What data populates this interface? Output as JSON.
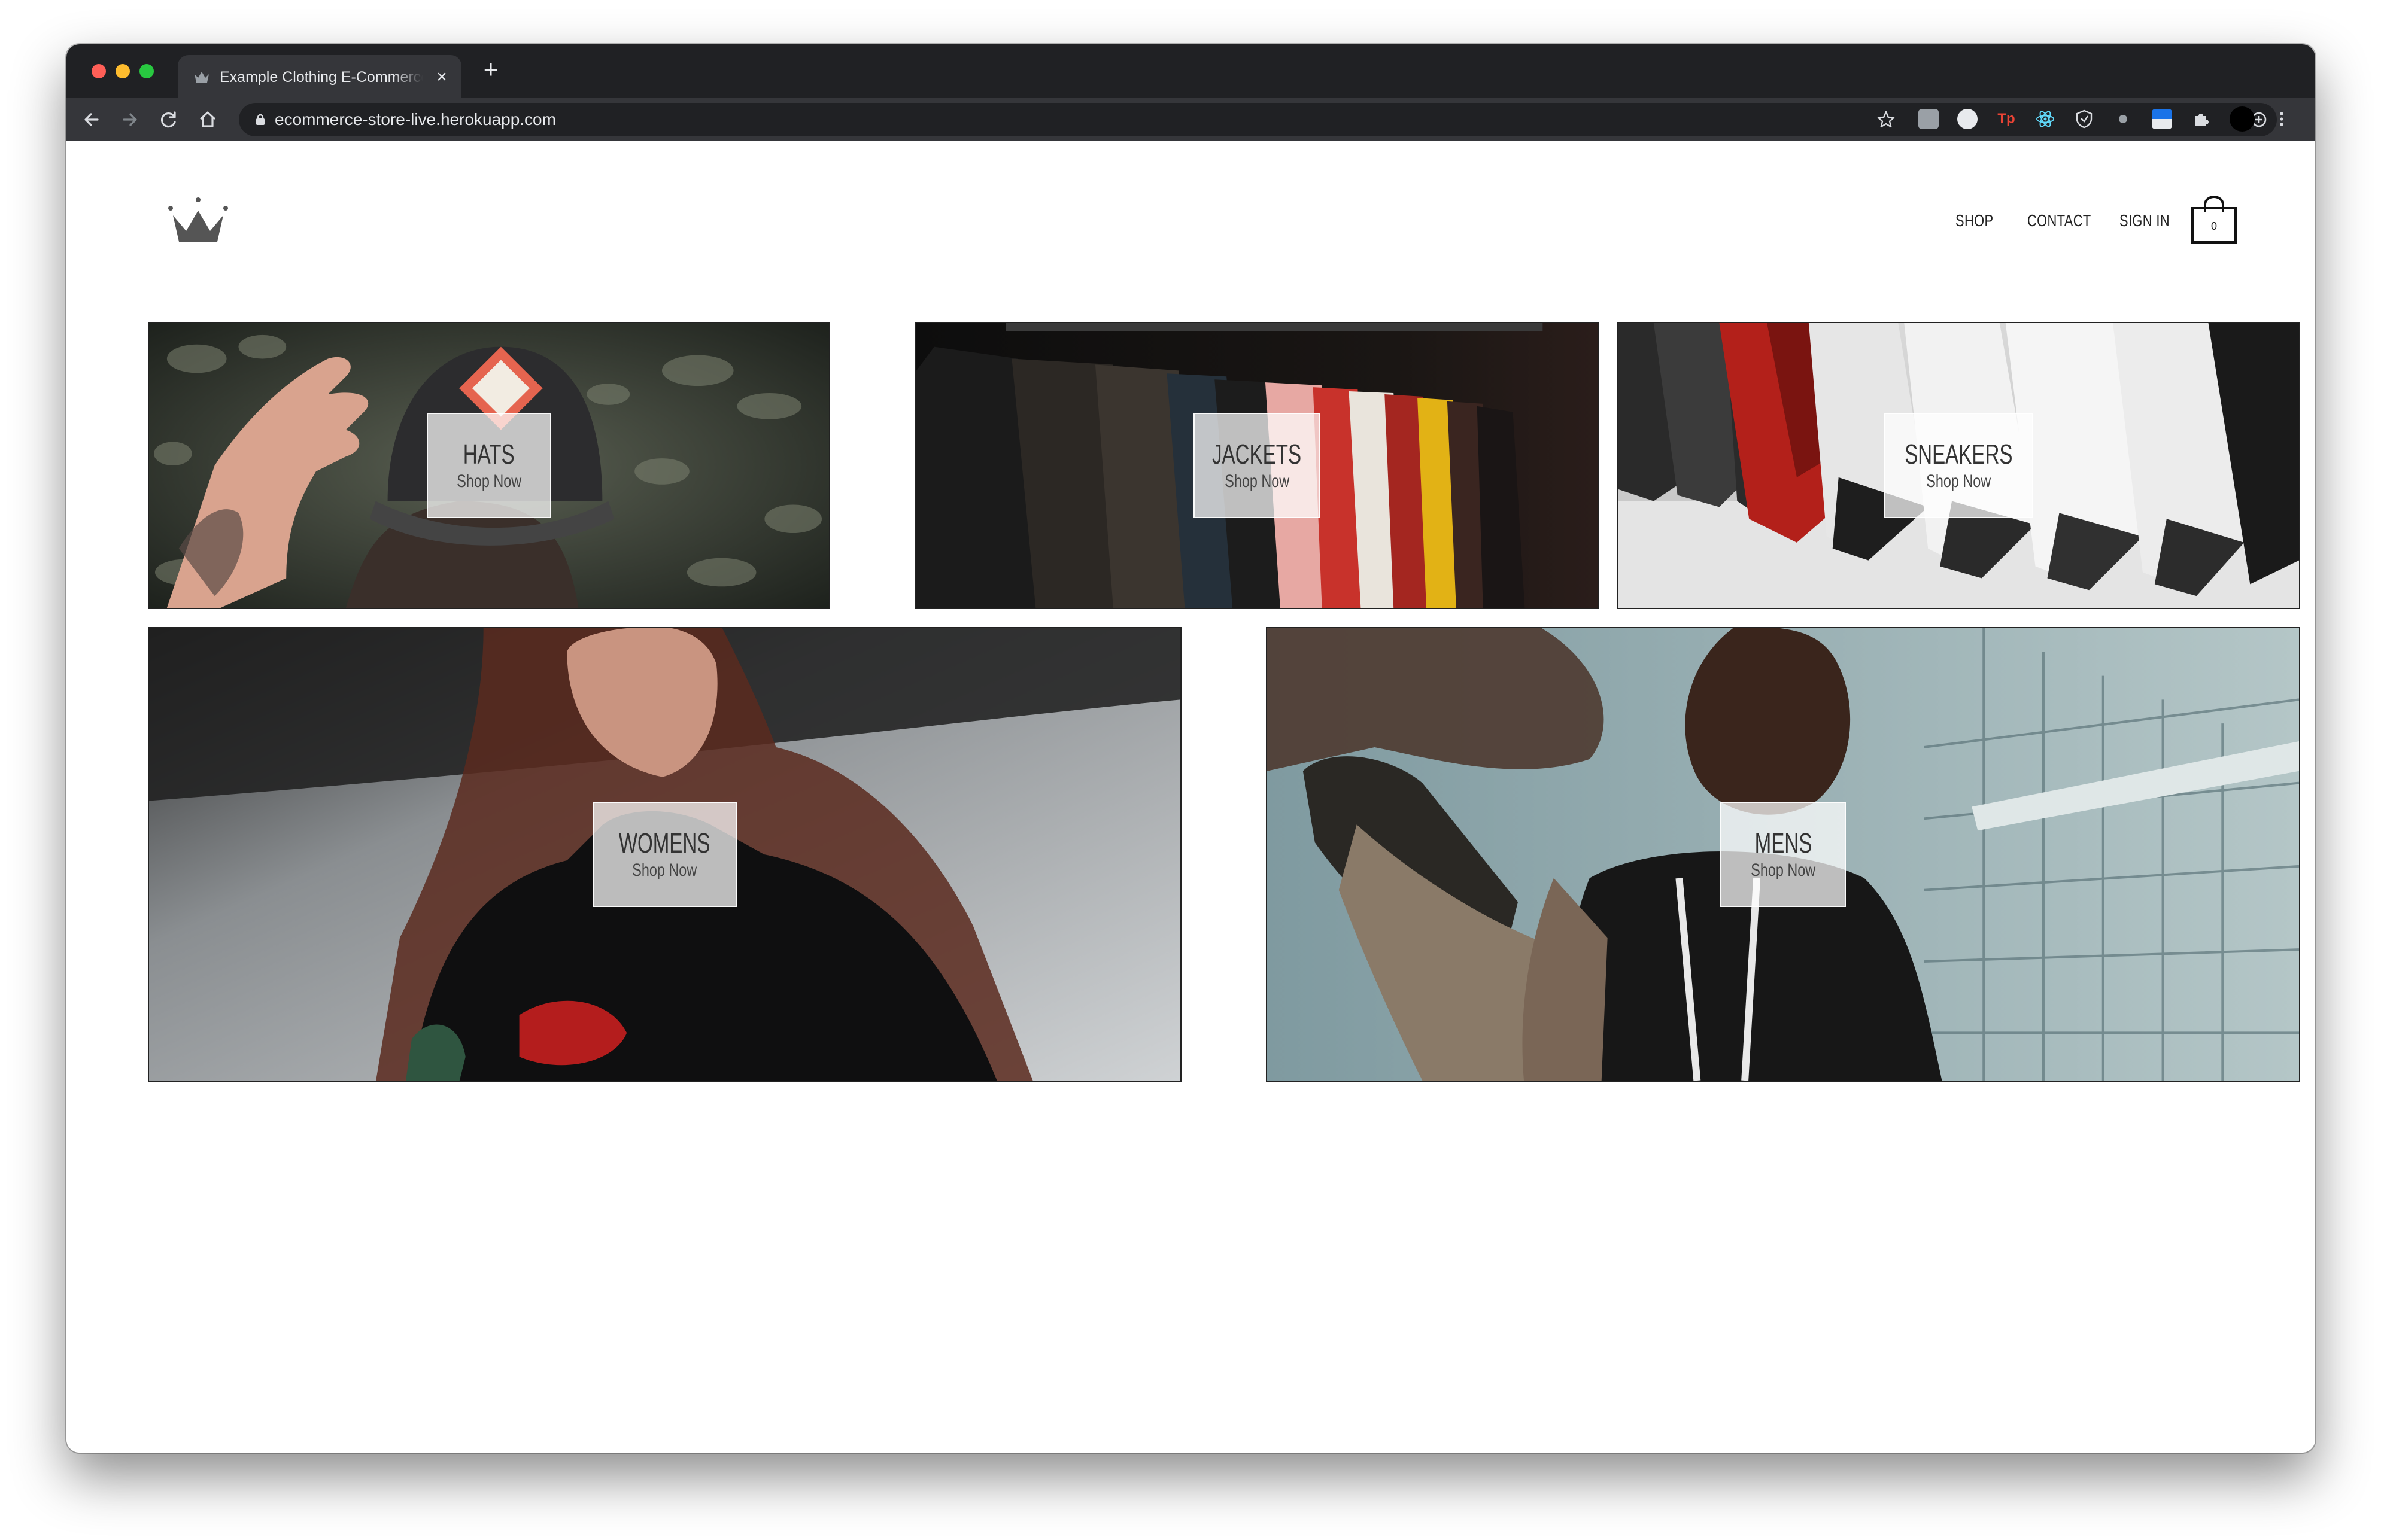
{
  "browser": {
    "tab_title": "Example Clothing E-Commerce",
    "tab_close": "×",
    "new_tab": "+",
    "url": "ecommerce-store-live.herokuapp.com",
    "icons": [
      "back-icon",
      "forward-icon",
      "reload-icon",
      "home-icon",
      "lock-icon",
      "zoom-icon",
      "bookmark-star-icon",
      "extensions-icon",
      "profile-avatar-icon",
      "menu-icon"
    ],
    "extension_labels": {
      "tp": "Tp"
    },
    "traffic_light_colors": [
      "#ff5f57",
      "#febc2e",
      "#28c840"
    ]
  },
  "header": {
    "logo": "crown-icon",
    "nav": [
      {
        "label": "SHOP"
      },
      {
        "label": "CONTACT"
      },
      {
        "label": "SIGN IN"
      }
    ],
    "cart_count": "0"
  },
  "directory": [
    {
      "title": "HATS",
      "subtitle": "Shop Now"
    },
    {
      "title": "JACKETS",
      "subtitle": "Shop Now"
    },
    {
      "title": "SNEAKERS",
      "subtitle": "Shop Now"
    },
    {
      "title": "WOMENS",
      "subtitle": "Shop Now"
    },
    {
      "title": "MENS",
      "subtitle": "Shop Now"
    }
  ]
}
